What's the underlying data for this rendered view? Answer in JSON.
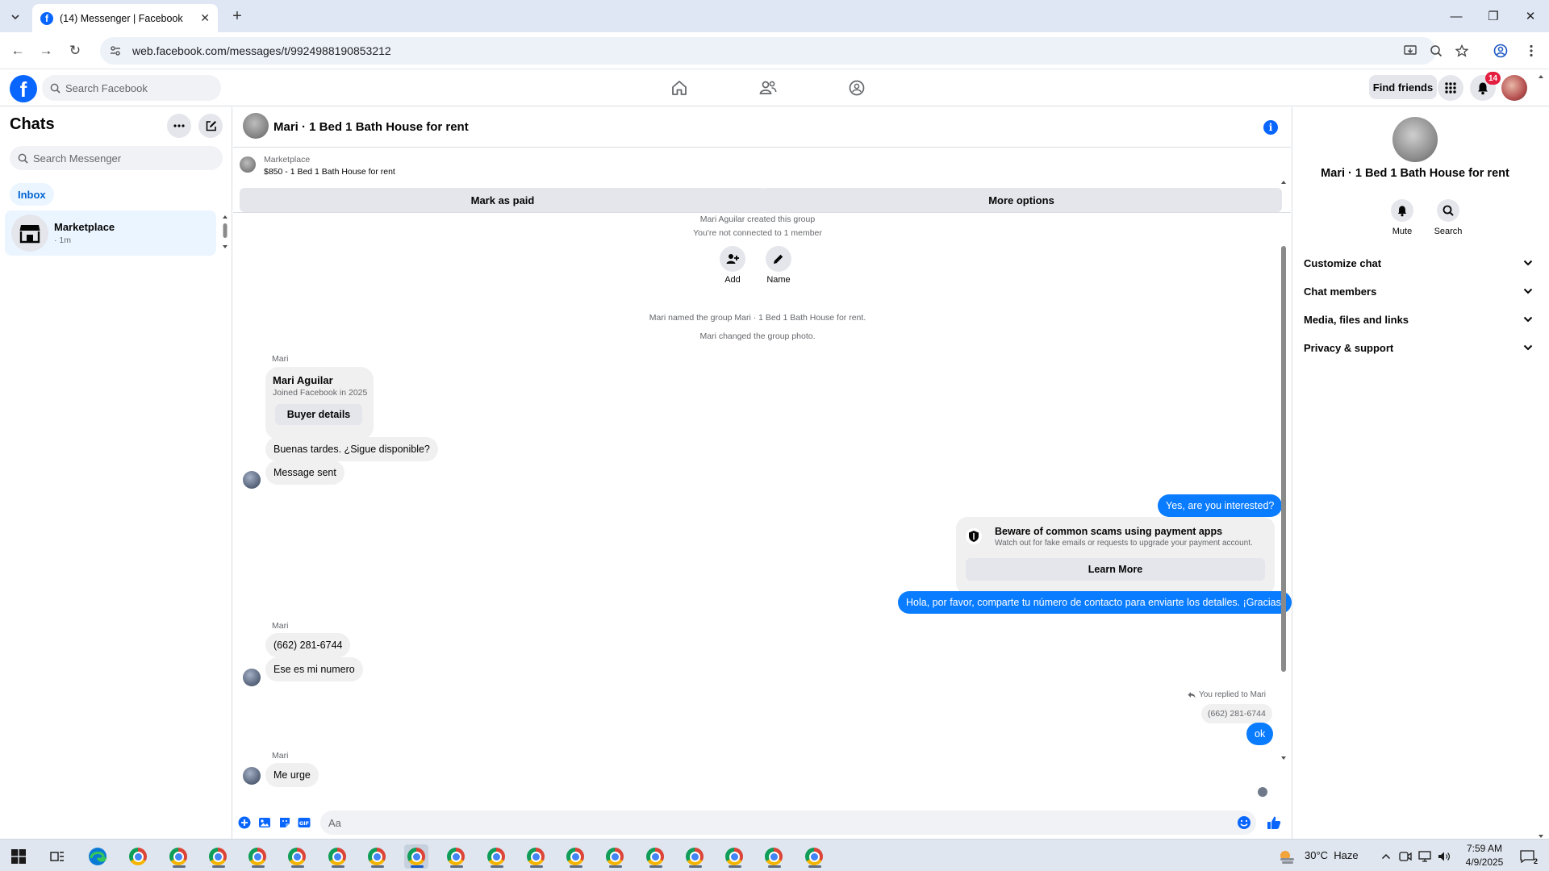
{
  "browser": {
    "tab_title": "(14) Messenger | Facebook",
    "url": "web.facebook.com/messages/t/9924988190853212"
  },
  "fb_header": {
    "search_placeholder": "Search Facebook",
    "find_friends_label": "Find friends",
    "notification_count": "14"
  },
  "sidebar": {
    "title": "Chats",
    "search_placeholder": "Search Messenger",
    "filter_label": "Inbox",
    "conversations": [
      {
        "name": "Marketplace",
        "time": "· 1m"
      }
    ]
  },
  "chat": {
    "title": "Mari · 1 Bed 1 Bath House for rent",
    "marketplace": {
      "label": "Marketplace",
      "listing": "$850 - 1 Bed 1 Bath House for rent",
      "mark_paid_label": "Mark as paid",
      "more_options_label": "More options"
    },
    "system": {
      "created": "Mari Aguilar created this group",
      "not_connected": "You're not connected to 1 member",
      "add_label": "Add",
      "name_label": "Name",
      "renamed": "Mari named the group Mari · 1 Bed 1 Bath House for rent.",
      "photo_changed": "Mari changed the group photo."
    },
    "buyer_card": {
      "sender": "Mari",
      "name": "Mari Aguilar",
      "joined": "Joined Facebook in 2025",
      "button": "Buyer details"
    },
    "messages": {
      "in_1": "Buenas tardes. ¿Sigue disponible?",
      "in_2": "Message sent",
      "out_1": "Yes, are you interested?",
      "out_2": "Hola, por favor, comparte tu número de contacto para enviarte los detalles. ¡Gracias!",
      "sender_2": "Mari",
      "in_3": "(662) 281-6744",
      "in_4": "Ese es mi numero",
      "reply_label": "You replied to Mari",
      "reply_quote": "(662) 281-6744",
      "out_3": "ok",
      "sender_3": "Mari",
      "in_5": "Me urge"
    },
    "scam_notice": {
      "title": "Beware of common scams using payment apps",
      "body": "Watch out for fake emails or requests to upgrade your payment account.",
      "button": "Learn More"
    },
    "composer_placeholder": "Aa"
  },
  "right_panel": {
    "name": "Mari · 1 Bed 1 Bath House for rent",
    "mute_label": "Mute",
    "search_label": "Search",
    "sections": [
      "Customize chat",
      "Chat members",
      "Media, files and links",
      "Privacy & support"
    ]
  },
  "taskbar": {
    "weather": "30°C  Haze",
    "time": "7:59 AM",
    "date": "4/9/2025",
    "notif_count": "2"
  },
  "colors": {
    "facebook_blue": "#0866ff",
    "outgoing_bubble": "#0a7cff",
    "badge_red": "#e41e3f"
  }
}
